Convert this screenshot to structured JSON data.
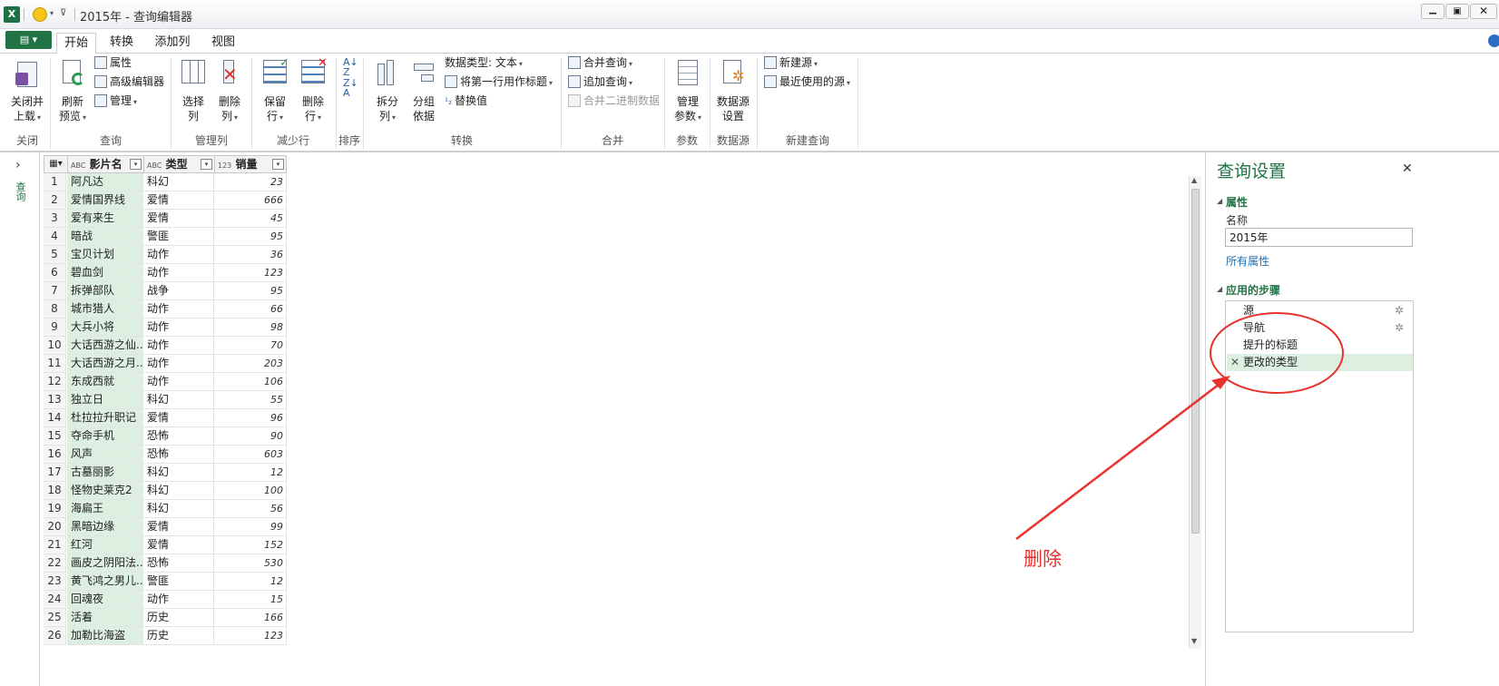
{
  "window": {
    "title": "2015年 - 查询编辑器"
  },
  "tabs": [
    {
      "label": "开始",
      "active": true
    },
    {
      "label": "转换"
    },
    {
      "label": "添加列"
    },
    {
      "label": "视图"
    }
  ],
  "ribbon": {
    "close_load": {
      "line1": "关闭并",
      "line2": "上载"
    },
    "refresh": {
      "line1": "刷新",
      "line2": "预览"
    },
    "properties": "属性",
    "advanced_editor": "高级编辑器",
    "manage": "管理",
    "choose_cols": {
      "line1": "选择",
      "line2": "列"
    },
    "remove_cols": {
      "line1": "删除",
      "line2": "列"
    },
    "keep_rows": {
      "line1": "保留",
      "line2": "行"
    },
    "remove_rows": {
      "line1": "删除",
      "line2": "行"
    },
    "split_col": {
      "line1": "拆分",
      "line2": "列"
    },
    "group_by": {
      "line1": "分组",
      "line2": "依据"
    },
    "data_type": "数据类型: 文本",
    "first_row_header": "将第一行用作标题",
    "replace_values": "替换值",
    "merge_queries": "合并查询",
    "append_queries": "追加查询",
    "combine_binaries": "合并二进制数据",
    "manage_params": {
      "line1": "管理",
      "line2": "参数"
    },
    "datasource_settings": {
      "line1": "数据源",
      "line2": "设置"
    },
    "new_source": "新建源",
    "recent_sources": "最近使用的源",
    "groups": [
      "关闭",
      "查询",
      "管理列",
      "减少行",
      "排序",
      "转换",
      "合并",
      "参数",
      "数据源",
      "新建查询"
    ]
  },
  "nav": {
    "label": "查询"
  },
  "table": {
    "columns": [
      {
        "type": "ABC",
        "name": "影片名"
      },
      {
        "type": "ABC",
        "name": "类型"
      },
      {
        "type": "123",
        "name": "销量"
      }
    ],
    "rows": [
      [
        "1",
        "阿凡达",
        "科幻",
        "23"
      ],
      [
        "2",
        "爱情国界线",
        "爱情",
        "666"
      ],
      [
        "3",
        "爱有来生",
        "爱情",
        "45"
      ],
      [
        "4",
        "暗战",
        "警匪",
        "95"
      ],
      [
        "5",
        "宝贝计划",
        "动作",
        "36"
      ],
      [
        "6",
        "碧血剑",
        "动作",
        "123"
      ],
      [
        "7",
        "拆弹部队",
        "战争",
        "95"
      ],
      [
        "8",
        "城市猎人",
        "动作",
        "66"
      ],
      [
        "9",
        "大兵小将",
        "动作",
        "98"
      ],
      [
        "10",
        "大话西游之仙...",
        "动作",
        "70"
      ],
      [
        "11",
        "大话西游之月...",
        "动作",
        "203"
      ],
      [
        "12",
        "东成西就",
        "动作",
        "106"
      ],
      [
        "13",
        "独立日",
        "科幻",
        "55"
      ],
      [
        "14",
        "杜拉拉升职记",
        "爱情",
        "96"
      ],
      [
        "15",
        "夺命手机",
        "恐怖",
        "90"
      ],
      [
        "16",
        "风声",
        "恐怖",
        "603"
      ],
      [
        "17",
        "古墓丽影",
        "科幻",
        "12"
      ],
      [
        "18",
        "怪物史莱克2",
        "科幻",
        "100"
      ],
      [
        "19",
        "海扁王",
        "科幻",
        "56"
      ],
      [
        "20",
        "黑暗边缘",
        "爱情",
        "99"
      ],
      [
        "21",
        "红河",
        "爱情",
        "152"
      ],
      [
        "22",
        "画皮之阴阳法...",
        "恐怖",
        "530"
      ],
      [
        "23",
        "黄飞鸿之男儿...",
        "警匪",
        "12"
      ],
      [
        "24",
        "回魂夜",
        "动作",
        "15"
      ],
      [
        "25",
        "活着",
        "历史",
        "166"
      ],
      [
        "26",
        "加勒比海盗",
        "历史",
        "123"
      ]
    ]
  },
  "query_settings": {
    "title": "查询设置",
    "properties_header": "属性",
    "name_label": "名称",
    "name_value": "2015年",
    "all_properties": "所有属性",
    "steps_header": "应用的步骤",
    "steps": [
      "源",
      "导航",
      "提升的标题",
      "更改的类型"
    ]
  },
  "annotation": {
    "text": "删除",
    "color": "#e8322e"
  },
  "colors": {
    "accent_green": "#217346",
    "selected_step": "#dcefe0"
  }
}
